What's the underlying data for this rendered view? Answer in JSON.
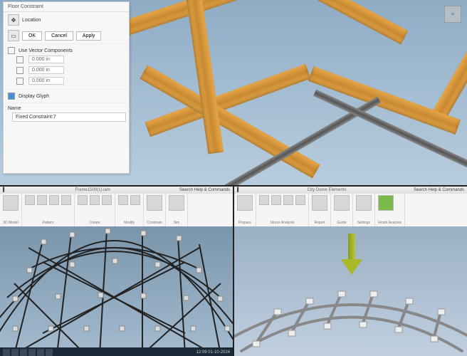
{
  "top_panel": {
    "title": "Floor Constraint",
    "loc_label": "Location",
    "btn_ok": "OK",
    "btn_cancel": "Cancel",
    "btn_apply": "Apply",
    "fix_label": "Use Vector Components",
    "v1": "0.000 in",
    "v2": "0.000 in",
    "v3": "0.000 in",
    "glyph_label": "Display Glyph",
    "name_label": "Name",
    "name_value": "Fixed Constraint:7",
    "home": "⌂"
  },
  "bot_left": {
    "doc_title": "Frame1500(1).iam",
    "search_ph": "Search Help & Commands",
    "grp1": "3D Model",
    "grp2": "Pattern",
    "grp3": "Create",
    "grp4": "Modify",
    "grp5": "Constrain",
    "grp6": "Sim",
    "tb_time": "12:09",
    "tb_date": "01-10-2024"
  },
  "bot_right": {
    "doc_title": "City Dome Elements",
    "search_ph": "Search Help & Commands",
    "grp1": "Prepare",
    "grp2": "Stress Analysis",
    "grp3": "Report",
    "grp4": "Guide",
    "grp5": "Settings",
    "grp6": "Finish Analysis"
  }
}
